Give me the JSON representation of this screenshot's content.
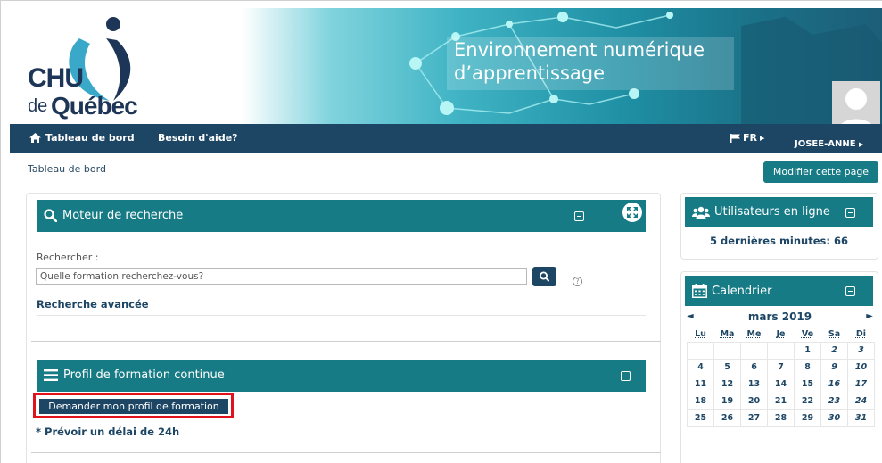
{
  "banner": {
    "logo_chu": "CHU",
    "logo_de": "de",
    "logo_quebec": "Québec",
    "title": "Environnement numérique d’apprentissage"
  },
  "navbar": {
    "home_label": "Tableau de bord",
    "help_label": "Besoin d'aide?",
    "lang_label": "FR",
    "user_label": "JOSEE-ANNE"
  },
  "breadcrumb": "Tableau de bord",
  "modify_button": "Modifier cette page",
  "search_block": {
    "title": "Moteur de recherche",
    "label": "Rechercher :",
    "placeholder": "Quelle formation recherchez-vous?",
    "advanced_link": "Recherche avancée"
  },
  "profile_block": {
    "title": "Profil de formation continue",
    "request_button": "Demander mon profil de formation",
    "note": "* Prévoir un délai de 24h"
  },
  "users_block": {
    "title": "Utilisateurs en ligne",
    "count_text": "5 dernières minutes: 66"
  },
  "calendar": {
    "title": "Calendrier",
    "month": "mars 2019",
    "prev": "◄",
    "next": "►",
    "days": [
      "Lu",
      "Ma",
      "Me",
      "Je",
      "Ve",
      "Sa",
      "Di"
    ],
    "weeks": [
      [
        "",
        "",
        "",
        "",
        "1",
        "2",
        "3"
      ],
      [
        "4",
        "5",
        "6",
        "7",
        "8",
        "9",
        "10"
      ],
      [
        "11",
        "12",
        "13",
        "14",
        "15",
        "16",
        "17"
      ],
      [
        "18",
        "19",
        "20",
        "21",
        "22",
        "23",
        "24"
      ],
      [
        "25",
        "26",
        "27",
        "28",
        "29",
        "30",
        "31"
      ]
    ]
  },
  "colors": {
    "teal": "#167b85",
    "navy": "#1d4665",
    "highlight": "#e0121c"
  }
}
